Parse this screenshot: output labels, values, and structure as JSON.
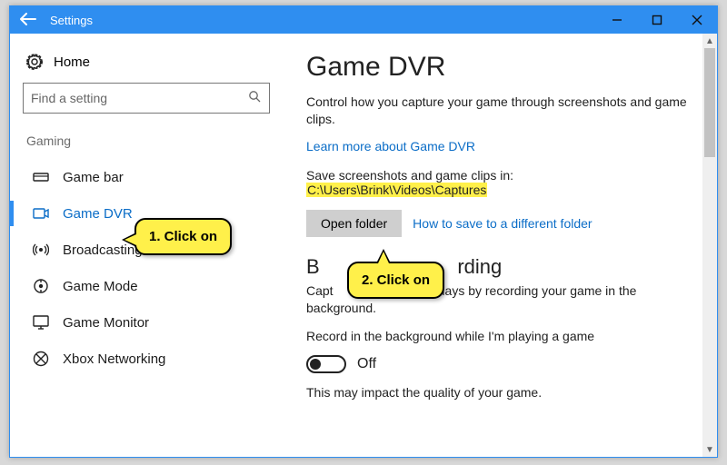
{
  "window": {
    "title": "Settings"
  },
  "sidebar": {
    "home": "Home",
    "search_placeholder": "Find a setting",
    "category": "Gaming",
    "items": [
      {
        "label": "Game bar"
      },
      {
        "label": "Game DVR"
      },
      {
        "label": "Broadcasting"
      },
      {
        "label": "Game Mode"
      },
      {
        "label": "Game Monitor"
      },
      {
        "label": "Xbox Networking"
      }
    ]
  },
  "main": {
    "title": "Game DVR",
    "desc": "Control how you capture your game through screenshots and game clips.",
    "learn_more": "Learn more about Game DVR",
    "save_prefix": "Save screenshots and game clips in: ",
    "save_path": "C:\\Users\\Brink\\Videos\\Captures",
    "open_folder": "Open folder",
    "how_to_link": "How to save to a different folder",
    "bg_heading_visible_left": "B",
    "bg_heading_visible_right": "rding",
    "bg_desc_visible_left": "Capt",
    "bg_desc_visible_right": "ous plays by recording your game in the background.",
    "record_label": "Record in the background while I'm playing a game",
    "toggle_state": "Off",
    "quality_note": "This may impact the quality of your game."
  },
  "callouts": {
    "c1": "1. Click on",
    "c2": "2. Click on"
  }
}
